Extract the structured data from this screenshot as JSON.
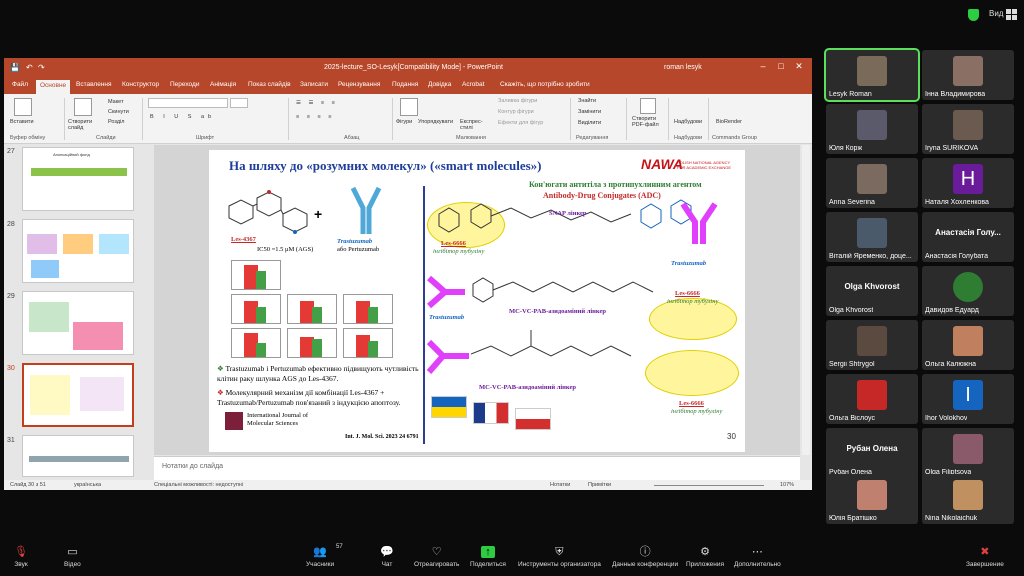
{
  "topbar": {
    "view_label": "Вид"
  },
  "ppt": {
    "window_title": "2025-lecture_SO-Lesyk[Compatibility Mode]  -  PowerPoint",
    "user": "roman lesyk",
    "tabs": [
      "Файл",
      "Основне",
      "Вставлення",
      "Конструктор",
      "Переходи",
      "Анімація",
      "Показ слайдів",
      "Записати",
      "Рецензування",
      "Подання",
      "Довідка",
      "Acrobat",
      "Скажіть, що потрібно зробити"
    ],
    "ribbon": {
      "paste": "Вставити",
      "create_slide": "Створити слайд",
      "layout": "Макет",
      "reset": "Скинути",
      "section": "Розділ",
      "shapes": "Фігури",
      "arrange": "Упорядкувати",
      "quick_styles": "Експрес-стилі",
      "fill": "Заливка фігури",
      "outline": "Контур фігури",
      "effects": "Ефекти для фігур",
      "find": "Знайти",
      "replace": "Замінити",
      "select": "Виділити",
      "create_pdf": "Створити PDF-файл",
      "groups": [
        "Буфер обміну",
        "Слайди",
        "Шрифт",
        "Абзац",
        "Малювання",
        "Редагування",
        "Adobe Acrobat",
        "Надбудови",
        "Commands Group"
      ],
      "addins": "Надбудови",
      "bioRender": "BioRender"
    },
    "thumbnails": [
      {
        "num": "27",
        "title": "Анонсаційний фонд"
      },
      {
        "num": "28",
        "title": ""
      },
      {
        "num": "29",
        "title": ""
      },
      {
        "num": "30",
        "title": ""
      },
      {
        "num": "31",
        "title": ""
      }
    ],
    "notes_placeholder": "Нотатки до слайда",
    "status": {
      "slide": "Слайд 30 з 51",
      "lang": "українська",
      "accessibility": "Спеціальні можливості: недоступні",
      "notes": "Нотатки",
      "comments": "Примітки",
      "zoom": "107%"
    }
  },
  "slide": {
    "title": "На шляху до «розумних молекул» («smart molecules»)",
    "logo": "NAWA",
    "logo_sub": "POLISH NATIONAL AGENCY FOR ACADEMIC EXCHANGE",
    "adc_title": "Кон'югати антитіла з протипухлинним агентом",
    "adc_subtitle": "Antibody-Drug Conjugates (ADC)",
    "les4367": "Les-4367",
    "ic50": "IC50 =1.5 μM (AGS)",
    "trast": "Trastuzumab",
    "or_pert": "або Pertuzumab",
    "les6666": "Les-6666",
    "inhibitor": "інгібітор тубуліну",
    "snap": "SNAP лінкер",
    "mcvc": "MC-VC-PAB-азидоаміний лінкер",
    "trastuzumab_label": "Trastuzumab",
    "bullet1": "Trastuzumab і Pertuzumab ефективно підвищують чутливість клітин раку шлунка AGS до Les-4367.",
    "bullet2": "Молекулярний механізм дії комбінації Les-4367 + Trastuzumab/Pertuzumab пов'язаний з індукцією апоптозу.",
    "journal": "International Journal of Molecular Sciences",
    "ref": "Int. J. Mol. Sci. 2023 24 6791",
    "page": "30"
  },
  "participants": [
    {
      "name": "Lesyk Roman",
      "kind": "video",
      "color": "#7a6a5a"
    },
    {
      "name": "Інна Владимирова",
      "kind": "video",
      "color": "#8a6f64"
    },
    {
      "name": "Юля Корж",
      "kind": "video",
      "color": "#5a5a6a"
    },
    {
      "name": "Iryna SURIKOVA",
      "kind": "video",
      "color": "#6a5a50"
    },
    {
      "name": "Anna Severina",
      "kind": "video",
      "color": "#7a6a60"
    },
    {
      "name": "Наталя Хохленкова",
      "kind": "letter",
      "letter": "H",
      "color": "#6a1b9a"
    },
    {
      "name": "Віталій Яременко, доце...",
      "kind": "photo",
      "color": "#4a5a6a"
    },
    {
      "name": "Анастасія Голубата",
      "kind": "text",
      "big": "Анастасія Голу..."
    },
    {
      "name": "Olga Khvorost",
      "kind": "text",
      "big": "Olga Khvorost"
    },
    {
      "name": "Давидов Едуард",
      "kind": "photo",
      "color": "#2e7d32"
    },
    {
      "name": "Sergii Shtrygol",
      "kind": "photo",
      "color": "#5a4a40"
    },
    {
      "name": "Ольга Калюжна",
      "kind": "photo",
      "color": "#c08060"
    },
    {
      "name": "Ольга Віслоус",
      "kind": "photo",
      "color": "#c62828"
    },
    {
      "name": "Ihor Volokhov",
      "kind": "letter",
      "letter": "I",
      "color": "#1565c0"
    },
    {
      "name": "Рубан Олена",
      "kind": "text",
      "big": "Рубан Олена"
    },
    {
      "name": "Olga Filiptsova",
      "kind": "photo",
      "color": "#8a5a6a"
    },
    {
      "name": "Юлія Братішко",
      "kind": "photo",
      "color": "#c08070"
    },
    {
      "name": "Nina Nikolaichuk",
      "kind": "photo",
      "color": "#c09060"
    }
  ],
  "toolbar": {
    "sound": "Звук",
    "video": "Відео",
    "participants": "Учасники",
    "participants_count": "57",
    "chat": "Чат",
    "react": "Отреагировать",
    "share": "Поделиться",
    "org_tools": "Инструменты организатора",
    "conf_data": "Данные конференции",
    "apps": "Приложения",
    "more": "Дополнительно",
    "end": "Завершение"
  }
}
